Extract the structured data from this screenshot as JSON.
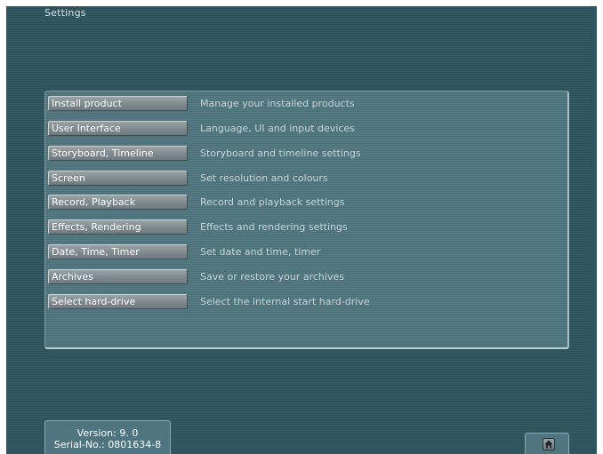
{
  "window": {
    "title": "Settings"
  },
  "menu": {
    "items": [
      {
        "label": "Install product",
        "description": "Manage your installed products"
      },
      {
        "label": "User Interface",
        "description": "Language, UI and input devices"
      },
      {
        "label": "Storyboard, Timeline",
        "description": "Storyboard and timeline settings"
      },
      {
        "label": "Screen",
        "description": "Set resolution and colours"
      },
      {
        "label": "Record, Playback",
        "description": "Record and playback settings"
      },
      {
        "label": "Effects, Rendering",
        "description": "Effects and rendering settings"
      },
      {
        "label": "Date, Time, Timer",
        "description": "Set date and time, timer"
      },
      {
        "label": "Archives",
        "description": "Save or restore your archives"
      },
      {
        "label": "Select hard-drive",
        "description": "Select the internal start hard-drive"
      }
    ]
  },
  "footer": {
    "version": "Version: 9. 0",
    "serial": "Serial-No.: 0801634-8",
    "home_icon": "home-icon"
  },
  "colors": {
    "background": "#2f545d",
    "panel": "#4f7580",
    "button": "#8a9598",
    "text": "#ffffff",
    "description_text": "#c7d4d7"
  }
}
